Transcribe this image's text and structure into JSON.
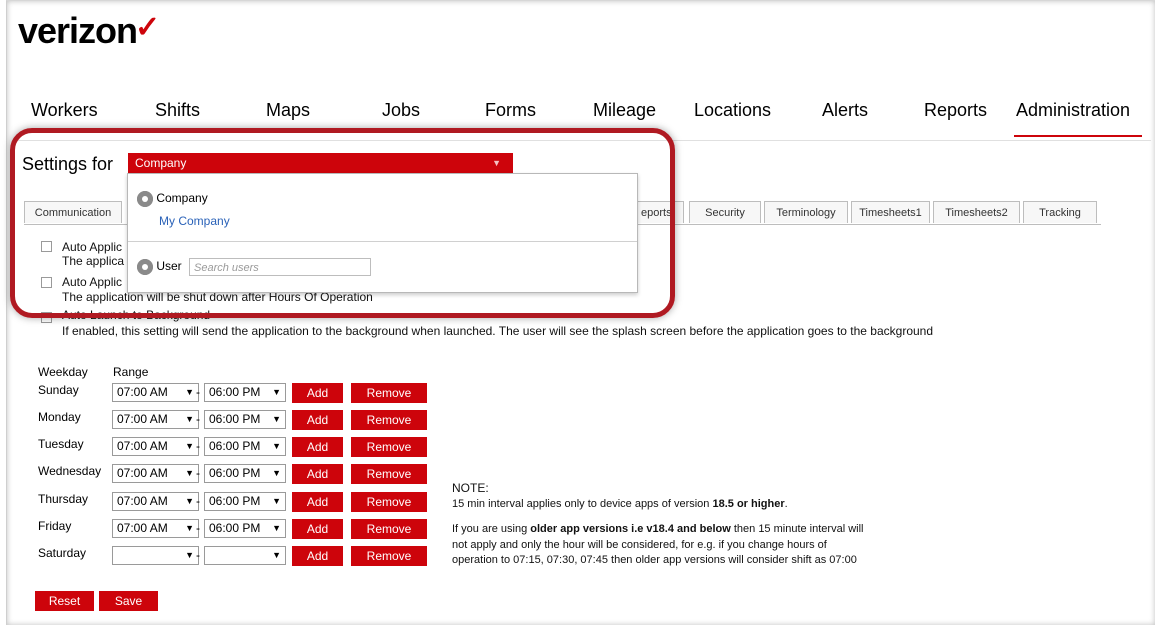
{
  "brand": {
    "name": "verizon",
    "mark": "✓"
  },
  "nav": [
    {
      "label": "Workers"
    },
    {
      "label": "Shifts"
    },
    {
      "label": "Maps"
    },
    {
      "label": "Jobs"
    },
    {
      "label": "Forms"
    },
    {
      "label": "Mileage"
    },
    {
      "label": "Locations"
    },
    {
      "label": "Alerts"
    },
    {
      "label": "Reports"
    },
    {
      "label": "Administration"
    }
  ],
  "settings": {
    "label": "Settings for",
    "selected": "Company",
    "dropdown": {
      "company_header": "Company",
      "company_item": "My Company",
      "user_header": "User",
      "user_search_placeholder": "Search users"
    }
  },
  "tabs": [
    {
      "label": "Communication"
    },
    {
      "label": "eports"
    },
    {
      "label": "Security"
    },
    {
      "label": "Terminology"
    },
    {
      "label": "Timesheets1"
    },
    {
      "label": "Timesheets2"
    },
    {
      "label": "Tracking"
    }
  ],
  "options": [
    {
      "label": "Auto Applic",
      "desc": "The applica"
    },
    {
      "label": "Auto Applic",
      "desc": "The application will be shut down after Hours Of Operation"
    },
    {
      "label": "Auto Launch to Background",
      "desc": "If enabled, this setting will send the application to the background when launched. The user will see the splash screen before the application goes to the background"
    }
  ],
  "schedule": {
    "col_weekday": "Weekday",
    "col_range": "Range",
    "add_label": "Add",
    "remove_label": "Remove",
    "dash": "-",
    "rows": [
      {
        "day": "Sunday",
        "start": "07:00 AM",
        "end": "06:00 PM"
      },
      {
        "day": "Monday",
        "start": "07:00 AM",
        "end": "06:00 PM"
      },
      {
        "day": "Tuesday",
        "start": "07:00 AM",
        "end": "06:00 PM"
      },
      {
        "day": "Wednesday",
        "start": "07:00 AM",
        "end": "06:00 PM"
      },
      {
        "day": "Thursday",
        "start": "07:00 AM",
        "end": "06:00 PM"
      },
      {
        "day": "Friday",
        "start": "07:00 AM",
        "end": "06:00 PM"
      },
      {
        "day": "Saturday",
        "start": "",
        "end": ""
      }
    ]
  },
  "note": {
    "title": "NOTE:",
    "line1_pre": "15 min interval applies only to device apps of version ",
    "line1_bold": "18.5 or higher",
    "line1_post": ".",
    "line2_pre": "If you are using ",
    "line2_bold": "older app versions i.e v18.4 and below",
    "line2_post": " then 15 minute interval will",
    "line3": "not apply and only the hour will be considered, for e.g. if you change hours of",
    "line4": "operation to 07:15, 07:30, 07:45 then older app versions will consider shift as 07:00"
  },
  "footer": {
    "reset_label": "Reset",
    "save_label": "Save"
  },
  "colors": {
    "accent": "#cd040b",
    "highlight_border": "#b01a22"
  }
}
